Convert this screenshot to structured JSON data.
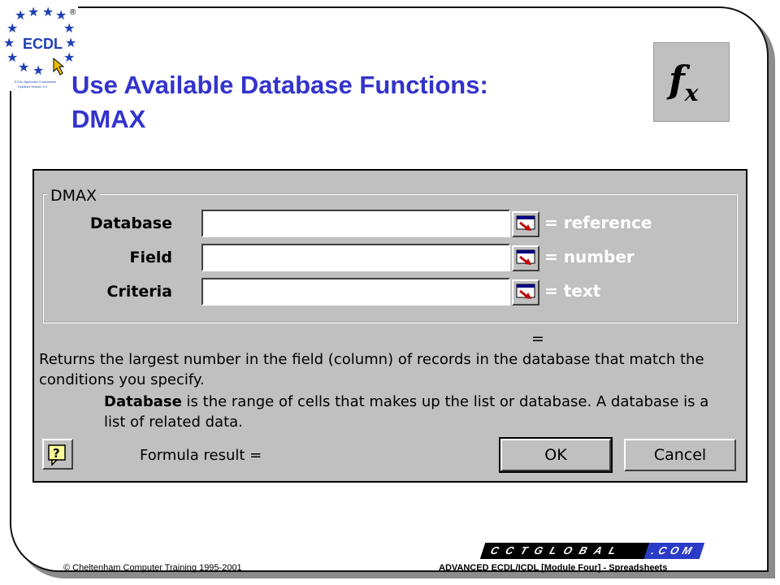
{
  "logo": {
    "text": "ECDL",
    "registered": "®",
    "caption_line1": "ECDL Approved Courseware",
    "caption_line2": "Syllabus Version 3.0"
  },
  "slide": {
    "title_line1": "Use Available Database Functions:",
    "title_line2": "DMAX",
    "fx_icon": "function-wizard-icon",
    "title_color": "#3333cc"
  },
  "dialog": {
    "group_title": "DMAX",
    "arguments": [
      {
        "label": "Database",
        "value": "",
        "type": "= reference"
      },
      {
        "label": "Field",
        "value": "",
        "type": "= number"
      },
      {
        "label": "Criteria",
        "value": "",
        "type": "= text"
      }
    ],
    "result_equals": "=",
    "description": "Returns the largest number in the field (column) of records in the database that match the conditions you specify.",
    "arg_help_name": "Database",
    "arg_help_text": "is the range of cells that makes up the list or database. A database is a list of related data.",
    "help_icon": "question-mark-icon",
    "formula_result": "Formula result =",
    "ok_label": "OK",
    "cancel_label": "Cancel"
  },
  "footer": {
    "brand_main": "CCTGLOBAL",
    "brand_suffix": ".COM",
    "copyright": "© Cheltenham Computer Training 1995-2001",
    "course": "ADVANCED ECDL/ICDL [Module Four]  -  Spreadsheets",
    "brand_accent": "#2a3cc7"
  }
}
